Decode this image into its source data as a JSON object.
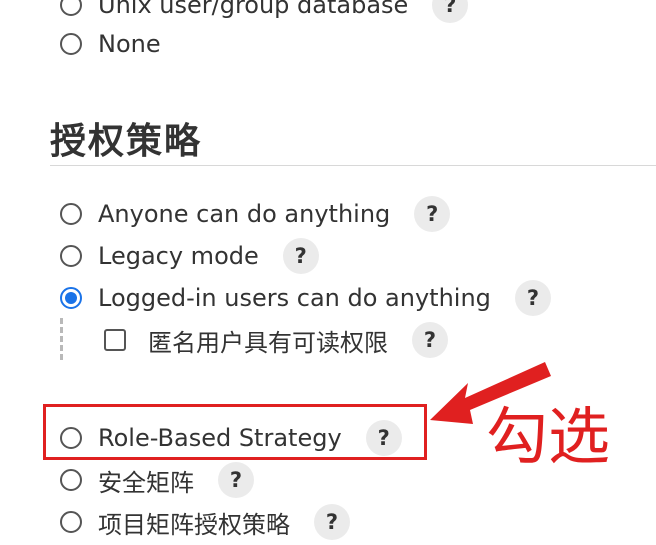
{
  "security_realm": {
    "options": [
      {
        "label": "Unix user/group database",
        "help": "?"
      },
      {
        "label": "None"
      }
    ]
  },
  "authorization": {
    "title": "授权策略",
    "options": [
      {
        "label": "Anyone can do anything",
        "help": "?",
        "selected": false
      },
      {
        "label": "Legacy mode",
        "help": "?",
        "selected": false
      },
      {
        "label": "Logged-in users can do anything",
        "help": "?",
        "selected": true
      },
      {
        "label": "Role-Based Strategy",
        "help": "?",
        "selected": false
      },
      {
        "label": "安全矩阵",
        "help": "?",
        "selected": false
      },
      {
        "label": "项目矩阵授权策略",
        "help": "?",
        "selected": false
      }
    ],
    "anonymous_read": {
      "label": "匿名用户具有可读权限",
      "help": "?",
      "checked": false
    }
  },
  "annotation": {
    "text": "勾选",
    "color": "#e02020"
  },
  "colors": {
    "accent": "#1a73e8",
    "annotation": "#e02020",
    "help_bg": "#ebebeb"
  }
}
